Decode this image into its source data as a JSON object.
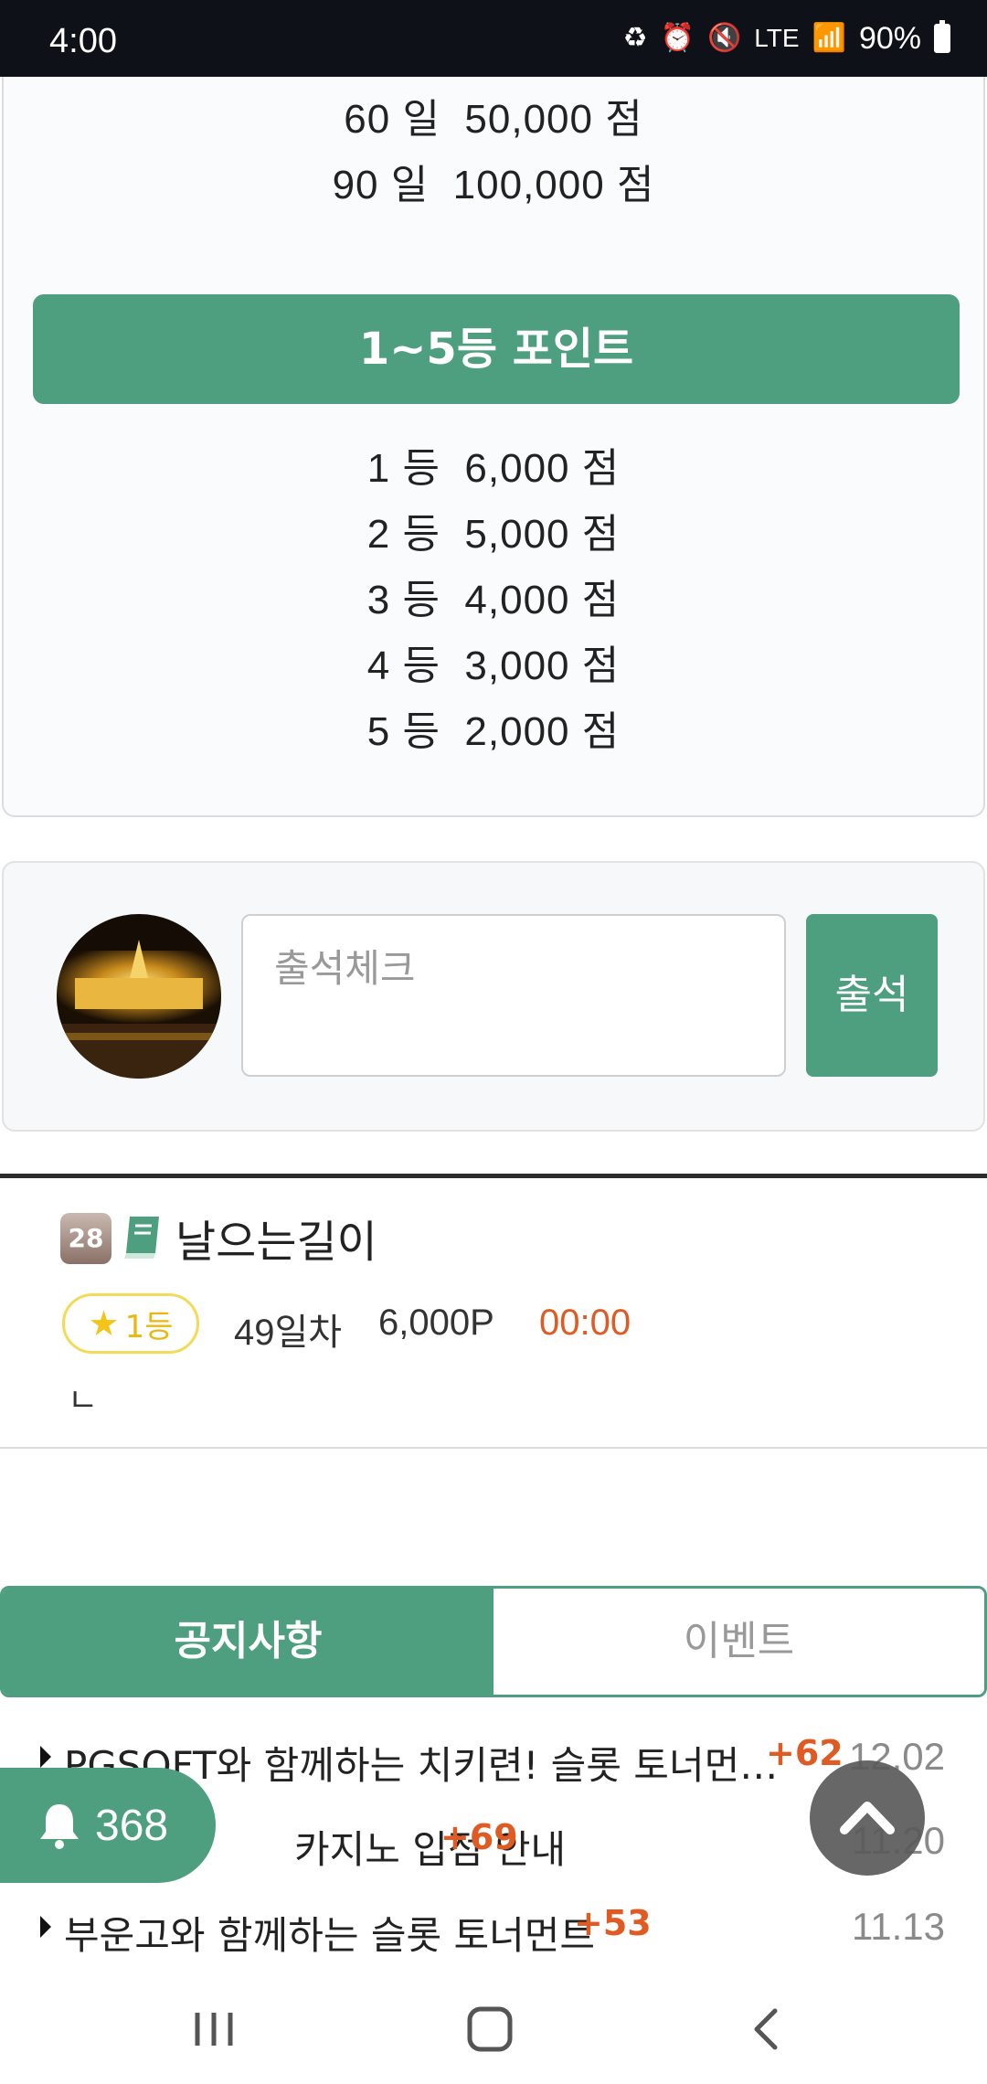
{
  "status_bar": {
    "time": "4:00",
    "network": "LTE",
    "battery": "90%"
  },
  "points": {
    "streak_lines": [
      {
        "days": "60 일",
        "points": "50,000 점"
      },
      {
        "days": "90 일",
        "points": "100,000 점"
      }
    ],
    "rank_banner": "1~5등 포인트",
    "rank_lines": [
      {
        "rank": "1 등",
        "points": "6,000 점"
      },
      {
        "rank": "2 등",
        "points": "5,000 점"
      },
      {
        "rank": "3 등",
        "points": "4,000 점"
      },
      {
        "rank": "4 등",
        "points": "3,000 점"
      },
      {
        "rank": "5 등",
        "points": "2,000 점"
      }
    ]
  },
  "attendance": {
    "placeholder": "출석체크",
    "submit_label": "출석"
  },
  "entry": {
    "level": "28",
    "username": "날으는길이",
    "rank_label": "1등",
    "day": "49일차",
    "points": "6,000P",
    "time": "00:00",
    "comment": "ㄴ"
  },
  "tabs": [
    {
      "label": "공지사항",
      "active": true
    },
    {
      "label": "이벤트",
      "active": false
    }
  ],
  "notices": [
    {
      "title": "PGSOFT와 함께하는 치키련! 슬롯 토너먼…",
      "count": "+62",
      "date": "12.02"
    },
    {
      "title": "카지노 입점 안내",
      "count": "+69",
      "date": "11.20"
    },
    {
      "title": "부운고와 함께하는 슬롯 토너먼트",
      "count": "+53",
      "date": "11.13"
    }
  ],
  "bell": {
    "count": "368"
  },
  "colors": {
    "accent": "#4e9e80",
    "highlight": "#e05a24",
    "rank_gold": "#f3da58"
  }
}
